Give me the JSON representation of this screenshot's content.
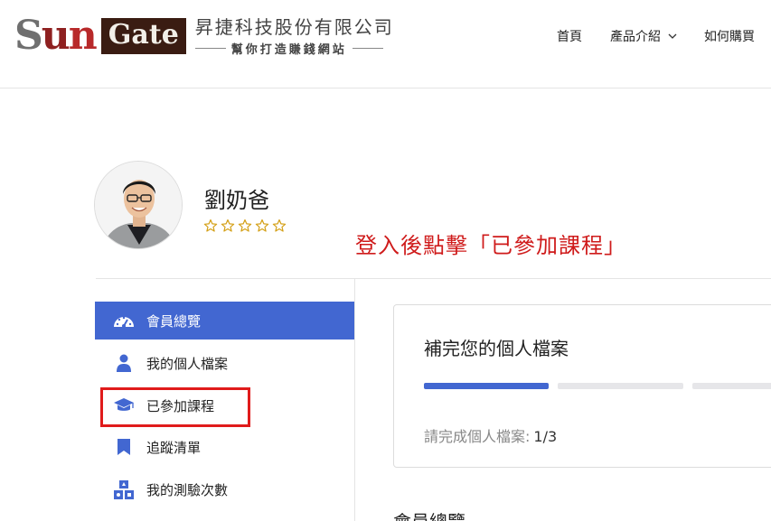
{
  "header": {
    "logo": {
      "sun_s": "S",
      "sun_u": "u",
      "sun_n": "n",
      "gate": "Gate",
      "company": "昇捷科技股份有限公司",
      "slogan": "幫你打造賺錢網站"
    },
    "nav": {
      "home": "首頁",
      "products": "產品介紹",
      "how_to_buy": "如何購買"
    }
  },
  "profile": {
    "name": "劉奶爸",
    "stars": 0,
    "stars_max": 5
  },
  "annotation": "登入後點擊「已參加課程」",
  "sidebar": {
    "items": [
      {
        "label": "會員總覽",
        "icon": "dashboard-icon",
        "active": true
      },
      {
        "label": "我的個人檔案",
        "icon": "user-icon",
        "active": false
      },
      {
        "label": "已參加課程",
        "icon": "graduation-cap-icon",
        "active": false
      },
      {
        "label": "追蹤清單",
        "icon": "bookmark-icon",
        "active": false
      },
      {
        "label": "我的測驗次數",
        "icon": "shapes-icon",
        "active": false
      }
    ]
  },
  "profile_card": {
    "title": "補完您的個人檔案",
    "progress_steps_completed": 1,
    "progress_steps_total": 3,
    "status_label": "請完成個人檔案:",
    "status_value": "1/3"
  },
  "main": {
    "section_title": "會員總覽"
  },
  "colors": {
    "accent": "#4267d1",
    "annotation_red": "#cf1b1b",
    "star_gold": "#d4a017",
    "highlight_red": "#e01b1b"
  }
}
